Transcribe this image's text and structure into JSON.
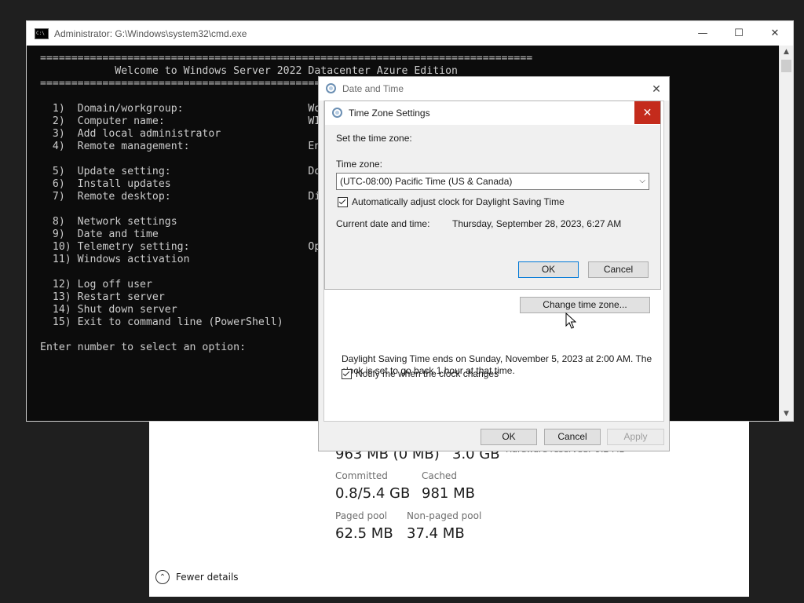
{
  "task_manager": {
    "stats_row0": {
      "left": "963 MB (0 MB)",
      "right": "3.0 GB",
      "hw_label": "Hardware reserved:",
      "hw_value": "9.2 MB"
    },
    "committed_label": "Committed",
    "committed_value": "0.8/5.4 GB",
    "cached_label": "Cached",
    "cached_value": "981 MB",
    "paged_label": "Paged pool",
    "paged_value": "62.5 MB",
    "nonpaged_label": "Non-paged pool",
    "nonpaged_value": "37.4 MB",
    "fewer_details": "Fewer details"
  },
  "cmd": {
    "title": "Administrator: G:\\Windows\\system32\\cmd.exe",
    "minimize": "—",
    "maximize": "☐",
    "close": "✕",
    "lines": [
      "===============================================================================",
      "            Welcome to Windows Server 2022 Datacenter Azure Edition",
      "===============================================================================",
      "",
      "  1)  Domain/workgroup:                    Wor",
      "  2)  Computer name:                       WIN",
      "  3)  Add local administrator",
      "  4)  Remote management:                   Ena",
      "",
      "  5)  Update setting:                      Dow",
      "  6)  Install updates",
      "  7)  Remote desktop:                      Dis",
      "",
      "  8)  Network settings",
      "  9)  Date and time",
      "  10) Telemetry setting:                   Opt",
      "  11) Windows activation",
      "",
      "  12) Log off user",
      "  13) Restart server",
      "  14) Shut down server",
      "  15) Exit to command line (PowerShell)",
      "",
      "Enter number to select an option:"
    ]
  },
  "date_time": {
    "title": "Date and Time",
    "close": "✕",
    "change_tz_button": "Change time zone...",
    "dst_info": "Daylight Saving Time ends on Sunday, November 5, 2023 at 2:00 AM. The clock is set to go back 1 hour at that time.",
    "notify_label": "Notify me when the clock changes",
    "notify_checked": true,
    "ok": "OK",
    "cancel": "Cancel",
    "apply": "Apply"
  },
  "tz_settings": {
    "title": "Time Zone Settings",
    "close": "✕",
    "set_label": "Set the time zone:",
    "tz_label": "Time zone:",
    "tz_value": "(UTC-08:00) Pacific Time (US & Canada)",
    "auto_dst_label": "Automatically adjust clock for Daylight Saving Time",
    "auto_dst_checked": true,
    "current_label": "Current date and time:",
    "current_value": "Thursday, September 28, 2023, 6:27 AM",
    "ok": "OK",
    "cancel": "Cancel"
  },
  "colors": {
    "close_red": "#c42b1c",
    "console_bg": "#0c0c0c",
    "console_text": "#cccccc",
    "primary_border": "#0078d7"
  }
}
